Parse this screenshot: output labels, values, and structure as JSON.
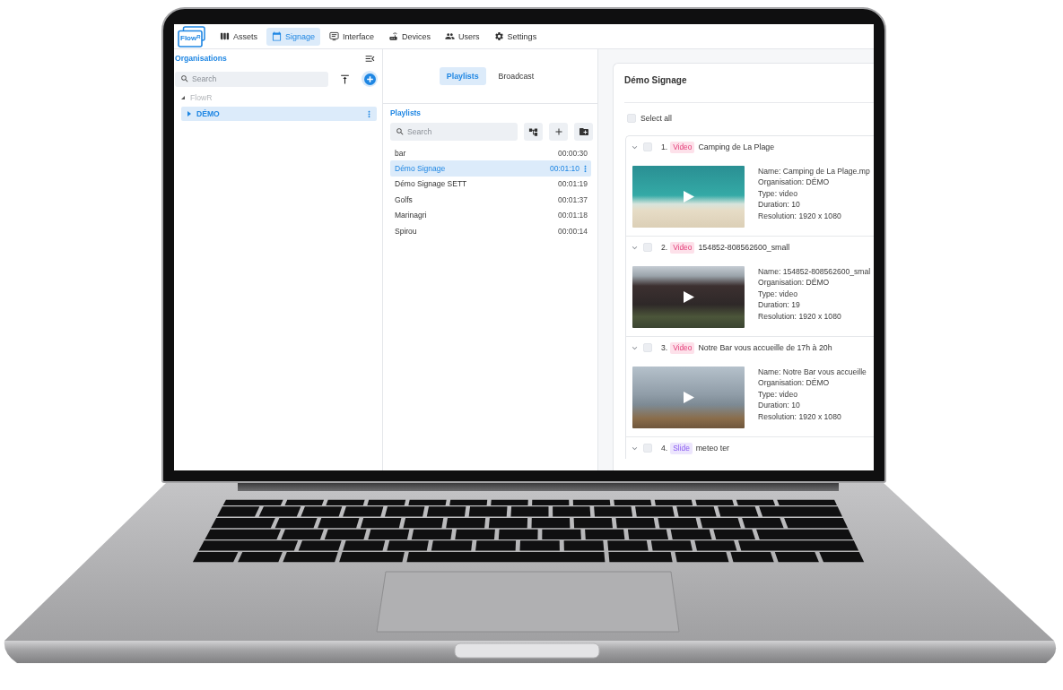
{
  "nav": {
    "logo_text": "Flow$^{R}$",
    "items": [
      {
        "label": "Assets",
        "selected": false
      },
      {
        "label": "Signage",
        "selected": true
      },
      {
        "label": "Interface",
        "selected": false
      },
      {
        "label": "Devices",
        "selected": false
      },
      {
        "label": "Users",
        "selected": false
      },
      {
        "label": "Settings",
        "selected": false
      }
    ]
  },
  "organisations": {
    "title": "Organisations",
    "search": {
      "placeholder": "Search"
    },
    "tree": [
      {
        "label": "FlowR",
        "expanded": true,
        "selected": false,
        "disabled": true,
        "children": [
          {
            "label": "DÉMO",
            "expanded": false,
            "selected": true,
            "disabled": false
          }
        ]
      }
    ]
  },
  "playlists_panel": {
    "tabs": [
      {
        "label": "Playlists",
        "selected": true
      },
      {
        "label": "Broadcast",
        "selected": false
      }
    ],
    "title": "Playlists",
    "search": {
      "placeholder": "Search"
    },
    "rows": [
      {
        "name": "bar",
        "duration": "00:00:30",
        "selected": false
      },
      {
        "name": "Démo Signage",
        "duration": "00:01:10",
        "selected": true
      },
      {
        "name": "Démo Signage SETT",
        "duration": "00:01:19",
        "selected": false
      },
      {
        "name": "Golfs",
        "duration": "00:01:37",
        "selected": false
      },
      {
        "name": "Marinagri",
        "duration": "00:01:18",
        "selected": false
      },
      {
        "name": "Spirou",
        "duration": "00:00:14",
        "selected": false
      }
    ]
  },
  "detail": {
    "title": "Démo Signage",
    "select_all": {
      "label": "Select all",
      "checked": false
    },
    "items": [
      {
        "number": "1.",
        "kind": "video",
        "type": "Video",
        "title": "Camping de La Plage",
        "checked": false,
        "expanded": true,
        "details": [
          "Name: Camping de La Plage.mp",
          "Organisation: DÉMO",
          "Type: video",
          "Duration: 10",
          "Resolution: 1920 x 1080"
        ]
      },
      {
        "number": "2.",
        "kind": "video",
        "type": "Video",
        "title": "154852-808562600_small",
        "checked": false,
        "expanded": true,
        "details": [
          "Name: 154852-808562600_smal",
          "Organisation: DÉMO",
          "Type: video",
          "Duration: 19",
          "Resolution: 1920 x 1080"
        ]
      },
      {
        "number": "3.",
        "kind": "video",
        "type": "Video",
        "title": "Notre Bar vous accueille de 17h à 20h",
        "checked": false,
        "expanded": true,
        "details": [
          "Name: Notre Bar vous accueille",
          "Organisation: DÉMO",
          "Type: video",
          "Duration: 10",
          "Resolution: 1920 x 1080"
        ]
      },
      {
        "number": "4.",
        "kind": "slide",
        "type": "Slide",
        "title": "meteo ter",
        "checked": false,
        "expanded": true
      }
    ]
  }
}
